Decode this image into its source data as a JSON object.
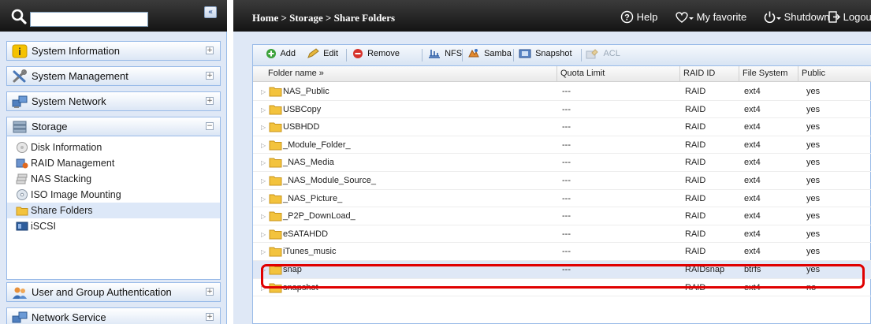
{
  "sidebar": {
    "search_placeholder": "",
    "collapse_glyph": "«",
    "sections": [
      {
        "label": "System Information",
        "icon": "info-icon"
      },
      {
        "label": "System Management",
        "icon": "tools-icon"
      },
      {
        "label": "System Network",
        "icon": "network-icon"
      },
      {
        "label": "Storage",
        "icon": "storage-icon"
      }
    ],
    "storage_items": [
      {
        "label": "Disk Information",
        "icon": "disk-icon"
      },
      {
        "label": "RAID Management",
        "icon": "raid-icon"
      },
      {
        "label": "NAS Stacking",
        "icon": "stacking-icon"
      },
      {
        "label": "ISO Image Mounting",
        "icon": "iso-icon"
      },
      {
        "label": "Share Folders",
        "icon": "folder-icon",
        "selected": true
      },
      {
        "label": "iSCSI",
        "icon": "iscsi-icon"
      }
    ],
    "bottom_sections": [
      {
        "label": "User and Group Authentication",
        "icon": "users-icon"
      },
      {
        "label": "Network Service",
        "icon": "network-service-icon"
      }
    ],
    "toggle_collapsed": "+",
    "toggle_expanded": "−"
  },
  "topbar": {
    "breadcrumb": "Home > Storage > Share Folders",
    "help": "Help",
    "favorite": "My favorite",
    "shutdown": "Shutdown",
    "logout": "Logout"
  },
  "toolbar": {
    "add": "Add",
    "edit": "Edit",
    "remove": "Remove",
    "nfs": "NFS",
    "samba": "Samba",
    "snapshot": "Snapshot",
    "acl": "ACL"
  },
  "grid": {
    "columns": [
      "Folder name »",
      "Quota Limit",
      "RAID ID",
      "File System",
      "Public"
    ],
    "rows": [
      {
        "name": "NAS_Public",
        "quota": "---",
        "raid": "RAID",
        "fs": "ext4",
        "public": "yes"
      },
      {
        "name": "USBCopy",
        "quota": "---",
        "raid": "RAID",
        "fs": "ext4",
        "public": "yes"
      },
      {
        "name": "USBHDD",
        "quota": "---",
        "raid": "RAID",
        "fs": "ext4",
        "public": "yes"
      },
      {
        "name": "_Module_Folder_",
        "quota": "---",
        "raid": "RAID",
        "fs": "ext4",
        "public": "yes"
      },
      {
        "name": "_NAS_Media",
        "quota": "---",
        "raid": "RAID",
        "fs": "ext4",
        "public": "yes"
      },
      {
        "name": "_NAS_Module_Source_",
        "quota": "---",
        "raid": "RAID",
        "fs": "ext4",
        "public": "yes"
      },
      {
        "name": "_NAS_Picture_",
        "quota": "---",
        "raid": "RAID",
        "fs": "ext4",
        "public": "yes"
      },
      {
        "name": "_P2P_DownLoad_",
        "quota": "---",
        "raid": "RAID",
        "fs": "ext4",
        "public": "yes"
      },
      {
        "name": "eSATAHDD",
        "quota": "---",
        "raid": "RAID",
        "fs": "ext4",
        "public": "yes"
      },
      {
        "name": "iTunes_music",
        "quota": "---",
        "raid": "RAID",
        "fs": "ext4",
        "public": "yes"
      },
      {
        "name": "snap",
        "quota": "---",
        "raid": "RAIDsnap",
        "fs": "btrfs",
        "public": "yes",
        "highlighted": true
      },
      {
        "name": "snapshot",
        "quota": "---",
        "raid": "RAID",
        "fs": "ext4",
        "public": "no"
      }
    ],
    "expander_glyph": "▷"
  },
  "colors": {
    "annotation_box": "#e00000",
    "folder": "#f3c33d",
    "panel_bg": "#dfe8f6",
    "header_border": "#99bbe8"
  }
}
